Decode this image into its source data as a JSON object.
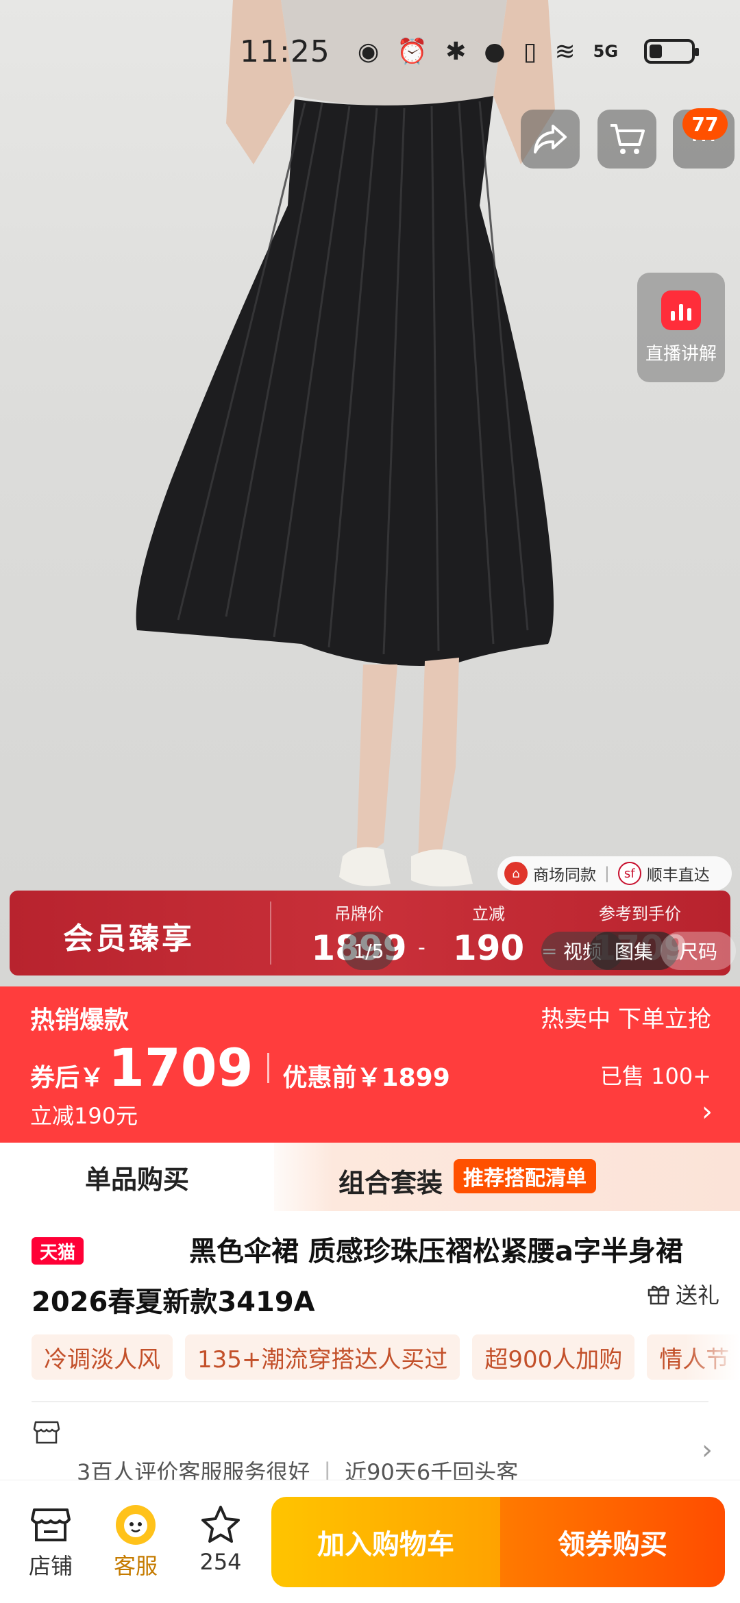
{
  "status_bar": {
    "time": "11:25",
    "network": "5G"
  },
  "top_actions": {
    "cart_badge": "77"
  },
  "live": {
    "label": "直播讲解"
  },
  "mall_tags": [
    "商场同款",
    "顺丰直达"
  ],
  "member_banner": {
    "title": "会员臻享",
    "tag_price_label": "吊牌价",
    "tag_price": "1899",
    "reduce_label": "立减",
    "reduce_value": "190",
    "ref_label": "参考到手价",
    "ref_value": "1709",
    "minus": "-",
    "equals": "="
  },
  "media_switch": {
    "video": "视频",
    "counter": "1/5",
    "gallery": "图集",
    "size": "尺码"
  },
  "price": {
    "hot_label": "热销爆款",
    "hot_right": "热卖中 下单立抢",
    "after_coupon_label": "券后￥",
    "after_coupon_price": "1709",
    "before_label": "优惠前￥1899",
    "sold": "已售 100+",
    "reduce_note": "立减190元",
    "chevron": "›"
  },
  "tabs": {
    "single": "单品购买",
    "combo": "组合套装",
    "recommend": "推荐搭配清单"
  },
  "product": {
    "platform_badge": "天猫",
    "title": "黑色伞裙 质感珍珠压褶松紧腰a字半身裙 2026春夏新款3419A",
    "gift_label": "送礼"
  },
  "tags": [
    "冷调淡人风",
    "135+潮流穿搭达人买过",
    "超900人加购",
    "情人节"
  ],
  "shop": {
    "review_note": "3百人评价客服服务很好",
    "separator": "|",
    "repeat_note": "近90天6千回头客",
    "chevron": "›"
  },
  "bottom_bar": {
    "shop_label": "店铺",
    "service_label": "客服",
    "favorite_count": "254",
    "add_cart": "加入购物车",
    "buy": "领券购买"
  },
  "colors": {
    "price_red": "#ff3d3d",
    "tmall_red": "#ff0036",
    "cart_yellow": "#ffb000",
    "buy_orange": "#ff5a00",
    "member_red": "#c0272f"
  }
}
